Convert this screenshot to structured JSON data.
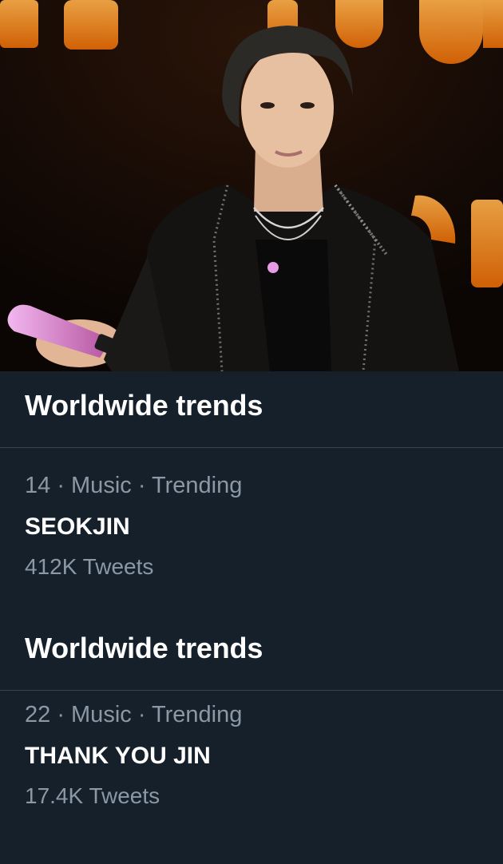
{
  "photo": {
    "alt": "Performer in black sparkling jacket holding pink microphone on stage",
    "background_color": "#0b0604",
    "stage_sign_color": "#ff8c1a",
    "microphone_color": "#e79be5"
  },
  "sections": [
    {
      "header": "Worldwide trends",
      "trend": {
        "meta": "14 · Music · Trending",
        "name": "SEOKJIN",
        "count": "412K Tweets"
      }
    },
    {
      "header": "Worldwide trends",
      "trend": {
        "meta": "22 · Music · Trending",
        "name": "THANK YOU JIN",
        "count": "17.4K Tweets"
      }
    }
  ],
  "colors": {
    "background": "#15202b",
    "divider": "#38444d",
    "secondary_text": "#8b98a5",
    "primary_text": "#ffffff"
  }
}
